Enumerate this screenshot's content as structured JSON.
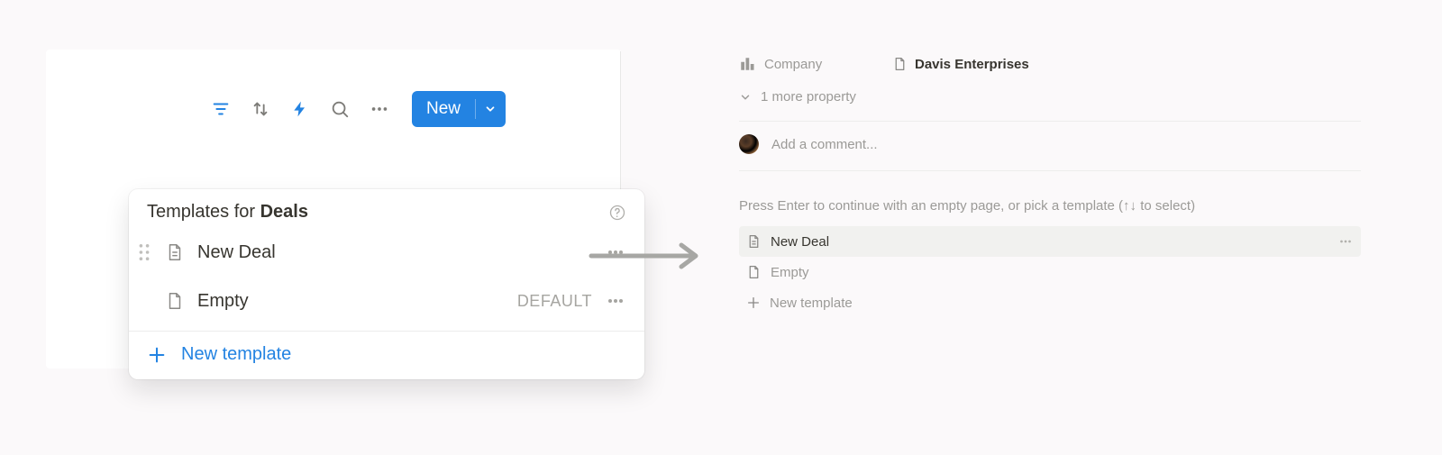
{
  "toolbar": {
    "new_label": "New"
  },
  "popover": {
    "title_prefix": "Templates for ",
    "database_name": "Deals",
    "items": [
      {
        "name": "New Deal",
        "default": false
      },
      {
        "name": "Empty",
        "default": true
      }
    ],
    "default_tag": "DEFAULT",
    "new_template_label": "New template"
  },
  "page": {
    "property": {
      "key": "Company",
      "value": "Davis Enterprises"
    },
    "more_properties": "1 more property",
    "comment_placeholder": "Add a comment...",
    "empty_hint": "Press Enter to continue with an empty page, or pick a template (↑↓ to select)",
    "templates": [
      {
        "name": "New Deal",
        "selected": true
      },
      {
        "name": "Empty",
        "selected": false
      }
    ],
    "new_template_label": "New template"
  }
}
